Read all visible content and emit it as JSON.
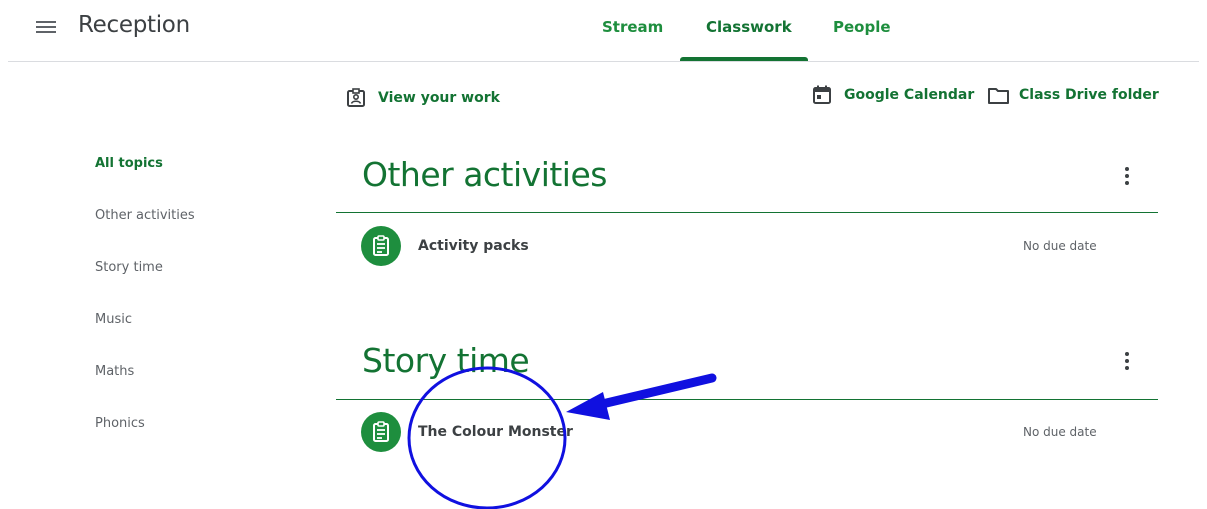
{
  "header": {
    "title": "Reception",
    "tabs": [
      "Stream",
      "Classwork",
      "People"
    ],
    "active_tab": "Classwork"
  },
  "toolbar": {
    "view_work": "View your work",
    "calendar": "Google Calendar",
    "drive": "Class Drive folder"
  },
  "sidebar": {
    "items": [
      "All topics",
      "Other activities",
      "Story time",
      "Music",
      "Maths",
      "Phonics"
    ],
    "active": "All topics"
  },
  "sections": [
    {
      "title": "Other activities",
      "items": [
        {
          "title": "Activity packs",
          "due": "No due date",
          "icon": "assignment-icon"
        }
      ]
    },
    {
      "title": "Story time",
      "items": [
        {
          "title": "The Colour Monster",
          "due": "No due date",
          "icon": "assignment-icon"
        }
      ]
    }
  ],
  "colors": {
    "accent": "#137333",
    "accent_light": "#1e8e3e",
    "annotation": "#1010e0"
  }
}
